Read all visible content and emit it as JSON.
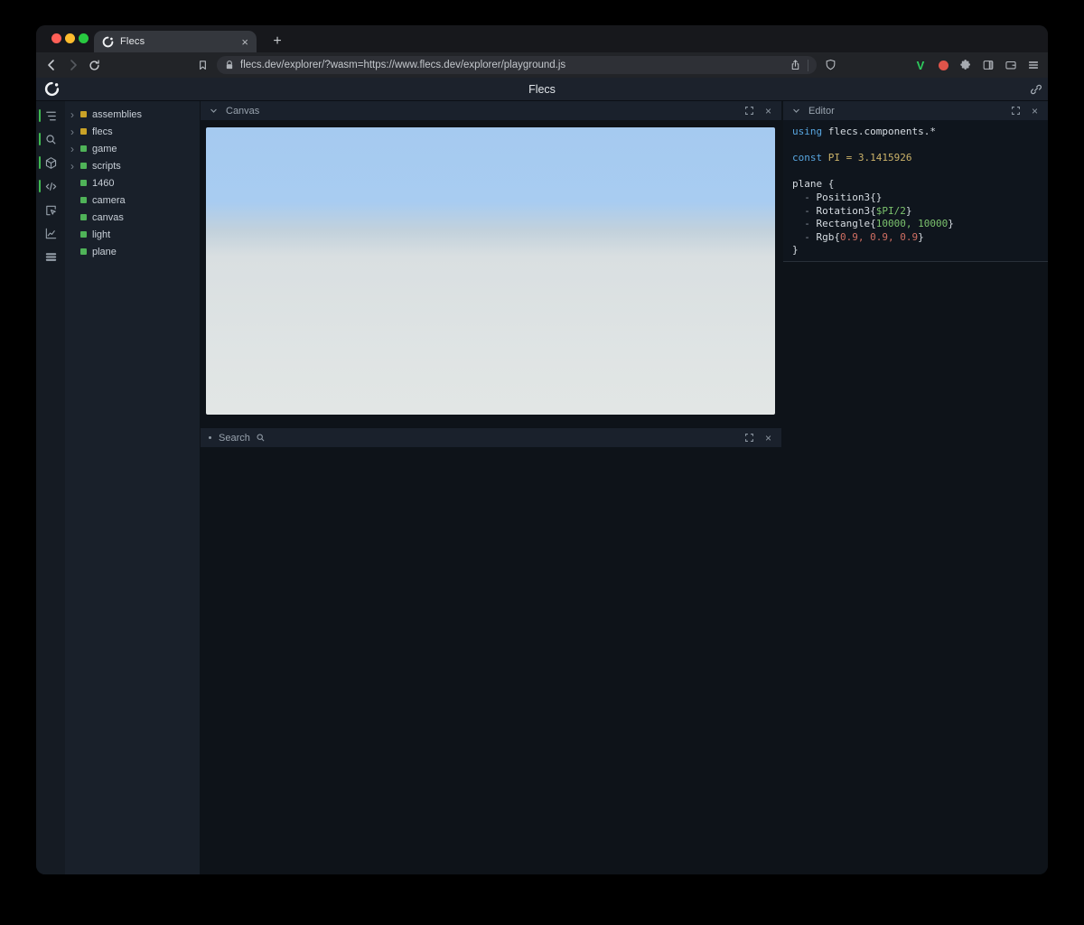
{
  "browser": {
    "tab_title": "Flecs",
    "url": "flecs.dev/explorer/?wasm=https://www.flecs.dev/explorer/playground.js"
  },
  "app": {
    "title": "Flecs"
  },
  "rail": {
    "items": [
      {
        "icon": "tree-icon",
        "active": true
      },
      {
        "icon": "search-icon",
        "active": true
      },
      {
        "icon": "cube-icon",
        "active": true
      },
      {
        "icon": "code-icon",
        "active": true
      },
      {
        "icon": "inspect-icon",
        "active": false
      },
      {
        "icon": "chart-icon",
        "active": false
      },
      {
        "icon": "stats-icon",
        "active": false
      }
    ]
  },
  "tree": {
    "items": [
      {
        "label": "assemblies",
        "color": "#c9a227",
        "expandable": true
      },
      {
        "label": "flecs",
        "color": "#c9a227",
        "expandable": true
      },
      {
        "label": "game",
        "color": "#4fb358",
        "expandable": true
      },
      {
        "label": "scripts",
        "color": "#4fb358",
        "expandable": true
      },
      {
        "label": "1460",
        "color": "#4fb358",
        "expandable": false
      },
      {
        "label": "camera",
        "color": "#4fb358",
        "expandable": false
      },
      {
        "label": "canvas",
        "color": "#4fb358",
        "expandable": false
      },
      {
        "label": "light",
        "color": "#4fb358",
        "expandable": false
      },
      {
        "label": "plane",
        "color": "#4fb358",
        "expandable": false
      }
    ]
  },
  "panels": {
    "canvas": {
      "title": "Canvas"
    },
    "search": {
      "title": "Search"
    },
    "editor": {
      "title": "Editor",
      "code_lines": [
        [
          {
            "t": "using ",
            "c": "kw"
          },
          {
            "t": "flecs.components.*",
            "c": "id"
          }
        ],
        [],
        [
          {
            "t": "const ",
            "c": "kw"
          },
          {
            "t": "PI = 3.1415926",
            "c": "yl"
          }
        ],
        [],
        [
          {
            "t": "plane {",
            "c": "id"
          }
        ],
        [
          {
            "t": "  - ",
            "c": "pu"
          },
          {
            "t": "Position3{}",
            "c": "id"
          }
        ],
        [
          {
            "t": "  - ",
            "c": "pu"
          },
          {
            "t": "Rotation3{",
            "c": "id"
          },
          {
            "t": "$PI/2",
            "c": "gr"
          },
          {
            "t": "}",
            "c": "id"
          }
        ],
        [
          {
            "t": "  - ",
            "c": "pu"
          },
          {
            "t": "Rectangle{",
            "c": "id"
          },
          {
            "t": "10000, 10000",
            "c": "gr"
          },
          {
            "t": "}",
            "c": "id"
          }
        ],
        [
          {
            "t": "  - ",
            "c": "pu"
          },
          {
            "t": "Rgb{",
            "c": "id"
          },
          {
            "t": "0.9, 0.9, 0.9",
            "c": "rd"
          },
          {
            "t": "}",
            "c": "id"
          }
        ],
        [
          {
            "t": "}",
            "c": "id"
          }
        ]
      ]
    }
  },
  "icons": {
    "tab_close": "×",
    "panel_close": "×",
    "new_tab": "+"
  },
  "colors": {
    "accent_green": "#4fb358",
    "module_yellow": "#c9a227",
    "canvas_sky": "#a8ccf1",
    "canvas_ground": "#dfe4e4"
  }
}
